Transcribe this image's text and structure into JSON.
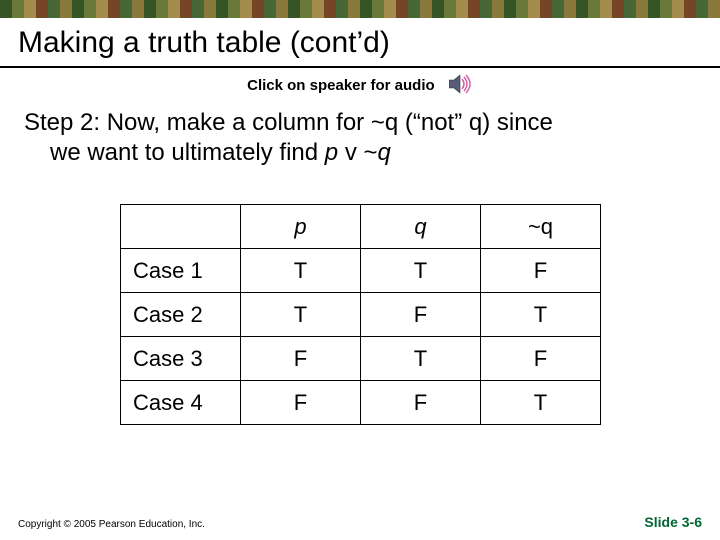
{
  "title": "Making a truth table (cont’d)",
  "audio_hint": "Click on speaker for audio",
  "step_line1": "Step 2: Now, make a column for ~q (“not” q) since",
  "step_line2": "we want to ultimately find ",
  "step_expr_1": "p",
  "step_expr_mid": " v ~",
  "step_expr_2": "q",
  "table": {
    "headers": [
      "",
      "p",
      "q",
      "~q"
    ],
    "rows": [
      {
        "label": "Case 1",
        "cells": [
          "T",
          "T",
          "F"
        ]
      },
      {
        "label": "Case 2",
        "cells": [
          "T",
          "F",
          "T"
        ]
      },
      {
        "label": "Case 3",
        "cells": [
          "F",
          "T",
          "F"
        ]
      },
      {
        "label": "Case 4",
        "cells": [
          "F",
          "F",
          "T"
        ]
      }
    ]
  },
  "copyright": "Copyright © 2005 Pearson Education, Inc.",
  "slide_label": "Slide ",
  "slide_num": "3-6",
  "chart_data": {
    "type": "table",
    "title": "Truth table for ~q",
    "columns": [
      "case",
      "p",
      "q",
      "~q"
    ],
    "rows": [
      [
        "Case 1",
        "T",
        "T",
        "F"
      ],
      [
        "Case 2",
        "T",
        "F",
        "T"
      ],
      [
        "Case 3",
        "F",
        "T",
        "F"
      ],
      [
        "Case 4",
        "F",
        "F",
        "T"
      ]
    ]
  }
}
